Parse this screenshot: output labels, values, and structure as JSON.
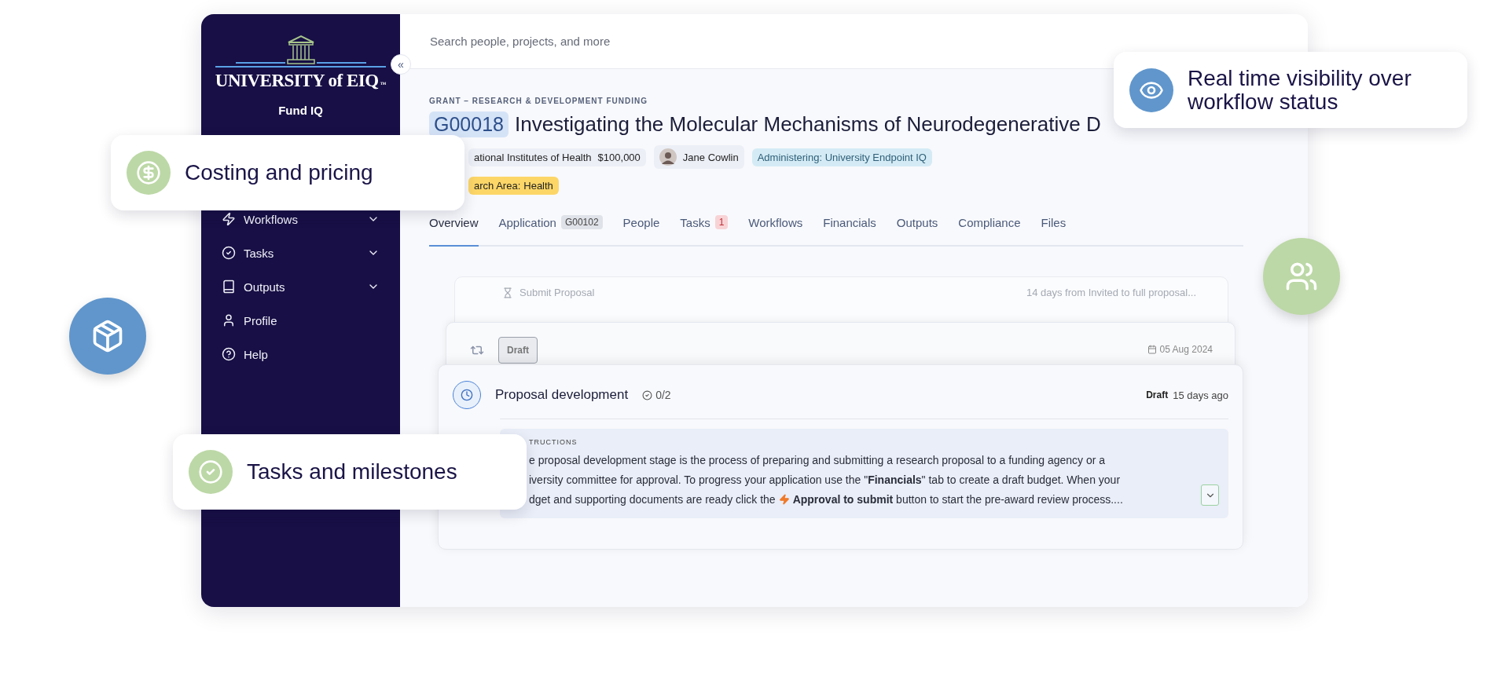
{
  "sidebar": {
    "logo_name": "UNIVERSITY of EIQ",
    "logo_mark": "™",
    "product": "Fund IQ",
    "collapse": "«",
    "items": [
      {
        "label": "Workflows",
        "kind": "zap",
        "expandable": true
      },
      {
        "label": "Tasks",
        "kind": "check",
        "expandable": true
      },
      {
        "label": "Outputs",
        "kind": "book",
        "expandable": true
      },
      {
        "label": "Profile",
        "kind": "user",
        "expandable": false
      },
      {
        "label": "Help",
        "kind": "help",
        "expandable": false
      }
    ]
  },
  "search": {
    "placeholder": "Search people, projects, and more"
  },
  "grant": {
    "category": "GRANT – RESEARCH & DEVELOPMENT FUNDING",
    "id": "G00018",
    "title": "Investigating the Molecular Mechanisms of Neurodegenerative D",
    "funder": "ational Institutes of Health",
    "amount": "$100,000",
    "person": "Jane Cowlin",
    "administering": "Administering: University Endpoint IQ",
    "area_label": "arch Area:",
    "area_value": "Health"
  },
  "tabs": [
    {
      "label": "Overview",
      "selected": true
    },
    {
      "label": "Application",
      "selected": false,
      "badge": {
        "text": "G00102",
        "kind": "neutral"
      }
    },
    {
      "label": "People",
      "selected": false
    },
    {
      "label": "Tasks",
      "selected": false,
      "badge": {
        "text": "1",
        "kind": "alert"
      }
    },
    {
      "label": "Workflows",
      "selected": false
    },
    {
      "label": "Financials",
      "selected": false
    },
    {
      "label": "Outputs",
      "selected": false
    },
    {
      "label": "Compliance",
      "selected": false
    },
    {
      "label": "Files",
      "selected": false
    }
  ],
  "timeline": {
    "back_card": {
      "label": "Submit Proposal",
      "note": "14 days from Invited to full proposal..."
    },
    "middle_card": {
      "status": "Draft",
      "date": "05 Aug 2024"
    },
    "stage": {
      "title": "Proposal development",
      "progress": "0/2",
      "status": "Draft",
      "age": "15 days ago",
      "instructions_label": "TRUCTIONS",
      "lines": [
        "e proposal development stage is the process of preparing and submitting a research proposal to a funding agency or a",
        "iversity committee for approval. To progress your application use the \"**Financials**\" tab to create a draft budget. When your"
      ],
      "last_before": "dget and supporting documents are ready click the",
      "last_after": "**Approval to submit** button to start the pre-award review process...."
    }
  },
  "callouts": [
    {
      "text": "Costing and pricing",
      "kind": "dollar",
      "color": "#bcd8a6"
    },
    {
      "text": "Real time visibility over workflow status",
      "kind": "eye",
      "color": "#6096cc"
    },
    {
      "text": "Tasks and milestones",
      "kind": "check",
      "color": "#bcd8a6"
    }
  ],
  "bubbles": [
    {
      "kind": "package",
      "color": "#6096cc"
    },
    {
      "kind": "people",
      "color": "#bcd8a6"
    }
  ]
}
